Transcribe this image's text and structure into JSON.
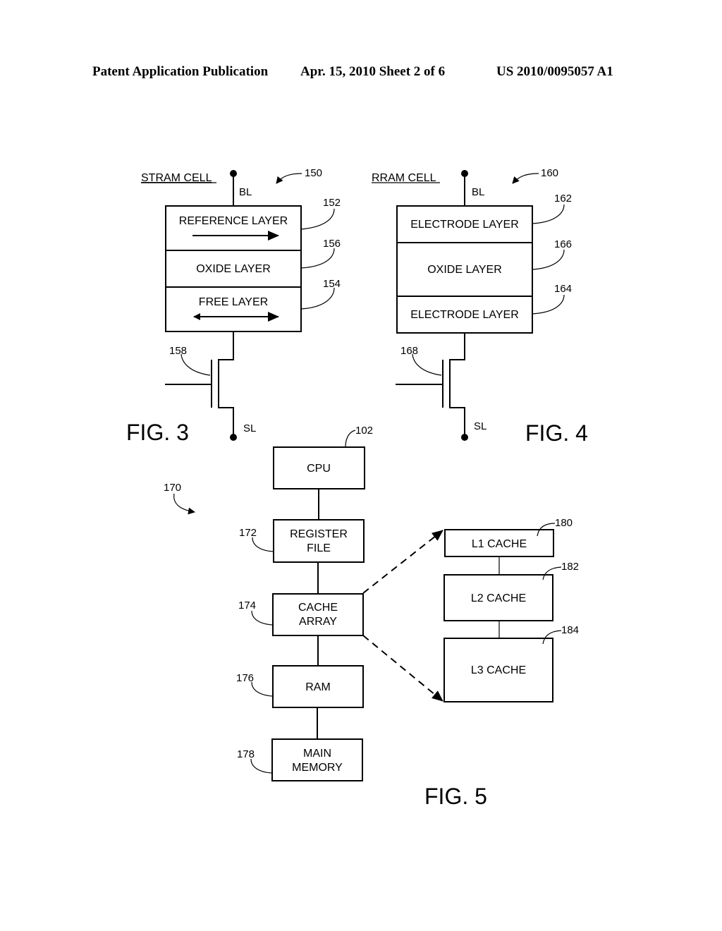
{
  "header": {
    "publication": "Patent Application Publication",
    "date_sheet": "Apr. 15, 2010  Sheet 2 of 6",
    "patent_number": "US 2010/0095057 A1"
  },
  "fig3": {
    "title": "STRAM CELL",
    "ref": "150",
    "bl": "BL",
    "sl": "SL",
    "layers": [
      {
        "label": "REFERENCE LAYER",
        "ref": "152",
        "arrow": "right"
      },
      {
        "label": "OXIDE LAYER",
        "ref": "156"
      },
      {
        "label": "FREE LAYER",
        "ref": "154",
        "arrow": "both"
      }
    ],
    "transistor_ref": "158",
    "caption": "FIG. 3"
  },
  "fig4": {
    "title": "RRAM CELL",
    "ref": "160",
    "bl": "BL",
    "sl": "SL",
    "layers": [
      {
        "label": "ELECTRODE LAYER",
        "ref": "162"
      },
      {
        "label": "OXIDE LAYER",
        "ref": "166"
      },
      {
        "label": "ELECTRODE LAYER",
        "ref": "164"
      }
    ],
    "transistor_ref": "168",
    "caption": "FIG. 4"
  },
  "fig5": {
    "ref": "170",
    "blocks": [
      {
        "line1": "CPU",
        "line2": "",
        "ref": "102"
      },
      {
        "line1": "REGISTER",
        "line2": "FILE",
        "ref": "172"
      },
      {
        "line1": "CACHE",
        "line2": "ARRAY",
        "ref": "174"
      },
      {
        "line1": "RAM",
        "line2": "",
        "ref": "176"
      },
      {
        "line1": "MAIN",
        "line2": "MEMORY",
        "ref": "178"
      }
    ],
    "cache_levels": [
      {
        "label": "L1 CACHE",
        "ref": "180"
      },
      {
        "label": "L2 CACHE",
        "ref": "182"
      },
      {
        "label": "L3 CACHE",
        "ref": "184"
      }
    ],
    "caption": "FIG. 5"
  }
}
